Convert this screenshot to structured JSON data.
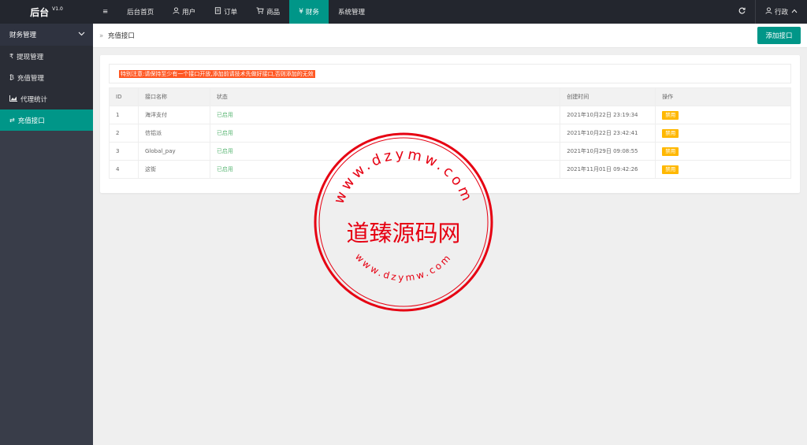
{
  "logo": {
    "name": "后台",
    "version": "V1.0"
  },
  "nav": {
    "menu_icon": "≡",
    "items": [
      {
        "label": "后台首页",
        "icon": ""
      },
      {
        "label": "用户",
        "icon": "user-icon"
      },
      {
        "label": "订单",
        "icon": "document-icon"
      },
      {
        "label": "商品",
        "icon": "cart-icon"
      },
      {
        "label": "财务",
        "icon": "yen-icon",
        "active": true
      },
      {
        "label": "系统管理",
        "icon": ""
      }
    ]
  },
  "top_right": {
    "user_label": "行政"
  },
  "sidebar": {
    "group": "财务管理",
    "items": [
      {
        "label": "提现管理",
        "icon": "₹"
      },
      {
        "label": "充值管理",
        "icon": "₿"
      },
      {
        "label": "代理统计",
        "icon": "chart-icon"
      },
      {
        "label": "充值接口",
        "icon": "⇄",
        "active": true
      }
    ]
  },
  "breadcrumb": {
    "label": "充值接口"
  },
  "toolbar": {
    "add_label": "添加接口"
  },
  "notice": "特别注意:请保持至少有一个接口开放,添加前请技术先做好接口,否则添加的无效",
  "table": {
    "headers": [
      "ID",
      "接口名称",
      "状态",
      "创建时间",
      "操作"
    ],
    "rows": [
      {
        "id": "1",
        "name": "海洋支付",
        "status": "已启用",
        "time": "2021年10月22日 23:19:34",
        "action": "禁用"
      },
      {
        "id": "2",
        "name": "信铝派",
        "status": "已启用",
        "time": "2021年10月22日 23:42:41",
        "action": "禁用"
      },
      {
        "id": "3",
        "name": "Global_pay",
        "status": "已启用",
        "time": "2021年10月29日 09:08:55",
        "action": "禁用"
      },
      {
        "id": "4",
        "name": "这街",
        "status": "已启用",
        "time": "2021年11月01日 09:42:26",
        "action": "禁用"
      }
    ]
  },
  "watermark": {
    "center": "道臻源码网",
    "ring_top": "www.dzymw.com",
    "ring_bottom": "www.dzymw.com"
  },
  "colors": {
    "accent": "#009688",
    "header": "#23262e",
    "sidebar": "#393d49",
    "notice": "#ff5722",
    "badge": "#FFB800",
    "ok": "#5FB878",
    "stamp": "#e60012"
  }
}
